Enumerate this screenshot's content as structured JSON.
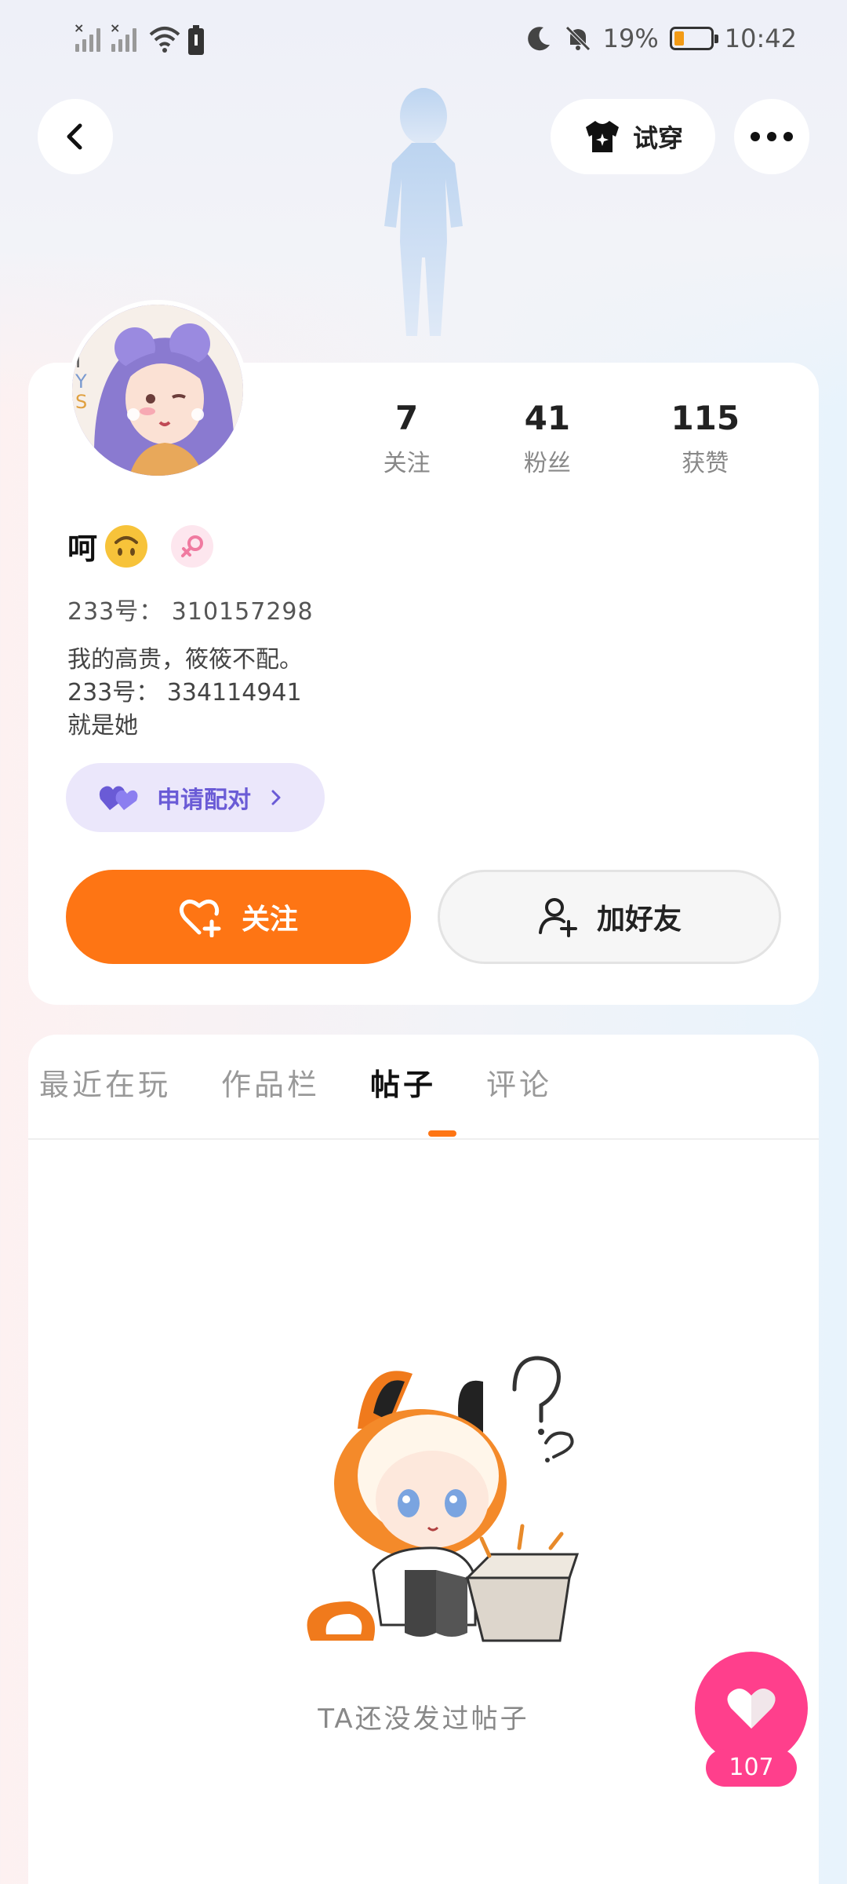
{
  "status_bar": {
    "battery_percent": "19%",
    "time": "10:42"
  },
  "header": {
    "tryon_label": "试穿"
  },
  "profile": {
    "stats": [
      {
        "value": "7",
        "label": "关注"
      },
      {
        "value": "41",
        "label": "粉丝"
      },
      {
        "value": "115",
        "label": "获赞"
      }
    ],
    "username": "呵",
    "uid": "233号： 310157298",
    "bio_lines": [
      "我的高贵，筱筱不配。",
      "233号： 334114941",
      "就是她"
    ],
    "pair_label": "申请配对",
    "follow_label": "关注",
    "add_friend_label": "加好友"
  },
  "tabs": [
    {
      "label": "最近在玩",
      "active": false
    },
    {
      "label": "作品栏",
      "active": false
    },
    {
      "label": "帖子",
      "active": true
    },
    {
      "label": "评论",
      "active": false
    }
  ],
  "empty_state": {
    "text": "TA还没发过帖子"
  },
  "like": {
    "count": "107"
  },
  "colors": {
    "accent_orange": "#fe7514",
    "pair_purple": "#6a5bd6",
    "like_pink": "#ff3f8c"
  },
  "icons": [
    "back-arrow-icon",
    "tshirt-icon",
    "more-dots-icon",
    "heart-plus-icon",
    "person-plus-icon",
    "hearts-icon",
    "chevron-right-icon",
    "female-icon",
    "heart-icon"
  ]
}
